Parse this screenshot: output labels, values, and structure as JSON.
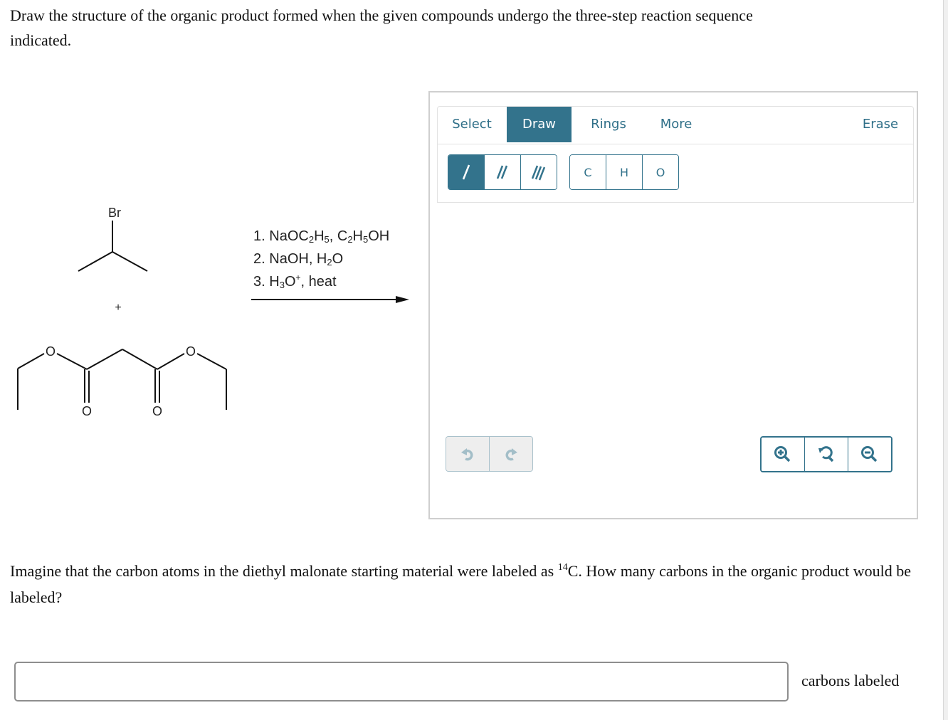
{
  "question1": "Draw the structure of the organic product formed when the given compounds undergo the three-step reaction sequence indicated.",
  "scheme": {
    "reactant1_label": "Br",
    "plus": "+",
    "ester_oxygen_label": "O",
    "carbonyl_oxygen_label": "O",
    "reagents": [
      {
        "num": "1.",
        "parts": [
          [
            "NaOC",
            ""
          ],
          [
            "2",
            "sub"
          ],
          [
            "H",
            ""
          ],
          [
            "5",
            "sub"
          ],
          [
            ", C",
            ""
          ],
          [
            "2",
            "sub"
          ],
          [
            "H",
            ""
          ],
          [
            "5",
            "sub"
          ],
          [
            "OH",
            ""
          ]
        ]
      },
      {
        "num": "2.",
        "parts": [
          [
            "NaOH, H",
            ""
          ],
          [
            "2",
            "sub"
          ],
          [
            "O",
            ""
          ]
        ]
      },
      {
        "num": "3.",
        "parts": [
          [
            "H",
            ""
          ],
          [
            "3",
            "sub"
          ],
          [
            "O",
            ""
          ],
          [
            "+",
            "sup"
          ],
          [
            ", heat",
            ""
          ]
        ]
      }
    ]
  },
  "editor": {
    "tabs": [
      {
        "label": "Select",
        "active": false
      },
      {
        "label": "Draw",
        "active": true
      },
      {
        "label": "Rings",
        "active": false
      },
      {
        "label": "More",
        "active": false
      }
    ],
    "erase_label": "Erase",
    "bond_tools": [
      "single-bond",
      "double-bond",
      "triple-bond"
    ],
    "atom_tools": [
      "C",
      "H",
      "O"
    ],
    "accent_color": "#33738c"
  },
  "question2": {
    "before": "Imagine that the carbon atoms in the diethyl malonate starting material were labeled as ",
    "isotope_mass": "14",
    "element": "C",
    "after": ". How many carbons in the organic product would be labeled?"
  },
  "answer": {
    "value": "",
    "unit": "carbons labeled"
  }
}
